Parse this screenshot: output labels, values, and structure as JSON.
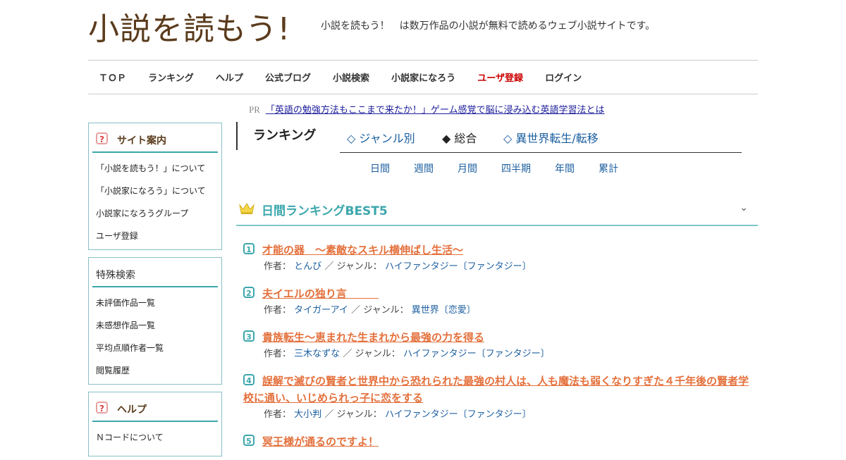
{
  "header": {
    "logo_text": "小説を読もう!",
    "tagline": "小説を読もう！　は数万作品の小説が無料で読めるウェブ小説サイトです。"
  },
  "nav": [
    {
      "label": "ＴＯＰ"
    },
    {
      "label": "ランキング"
    },
    {
      "label": "ヘルプ"
    },
    {
      "label": "公式ブログ"
    },
    {
      "label": "小説検索"
    },
    {
      "label": "小説家になろう"
    },
    {
      "label": "ユーザ登録",
      "color": "#cc0000"
    },
    {
      "label": "ログイン"
    }
  ],
  "pr": {
    "label": "PR",
    "link_text": "「英語の勉強方法もここまで来たか！」ゲーム感覚で脳に浸み込む英語学習法とは"
  },
  "sidebar": {
    "site_guide": {
      "title": "サイト案内",
      "items": [
        "「小説を読もう！」について",
        "「小説家になろう」について",
        "小説家になろうグループ",
        "ユーザ登録"
      ]
    },
    "special_search": {
      "title": "特殊検索",
      "items": [
        "未評価作品一覧",
        "未感想作品一覧",
        "平均点順作者一覧",
        "閲覧履歴"
      ]
    },
    "help": {
      "title": "ヘルプ",
      "items": [
        "Ｎコードについて"
      ]
    }
  },
  "ranking": {
    "title": "ランキング",
    "tabs": [
      "◇ ジャンル別",
      "◆ 総合",
      "◇ 異世界転生/転移"
    ],
    "active_tab": 1,
    "periods": [
      "日間",
      "週間",
      "月間",
      "四半期",
      "年間",
      "累計"
    ],
    "best5_title": "日間ランキングBEST5",
    "author_label": "作者：",
    "genre_label": "／ ジャンル：",
    "items": [
      {
        "rank": "1",
        "title": "才能の器　～素敵なスキル横伸ばし生活～",
        "author": "とんび",
        "genre": "ハイファンタジー〔ファンタジー〕"
      },
      {
        "rank": "2",
        "title": "夫イエルの独り言　　　",
        "author": "タイガーアイ",
        "genre": "異世界〔恋愛〕"
      },
      {
        "rank": "3",
        "title": "貴族転生～恵まれた生まれから最強の力を得る",
        "author": "三木なずな",
        "genre": "ハイファンタジー〔ファンタジー〕"
      },
      {
        "rank": "4",
        "title": "誤解で滅びの賢者と世界中から恐れられた最強の村人は、人も魔法も弱くなりすぎた４千年後の賢者学校に通い、いじめられっ子に恋をする",
        "author": "大小判",
        "genre": "ハイファンタジー〔ファンタジー〕"
      },
      {
        "rank": "5",
        "title": "冥王様が通るのですよ！",
        "author": "",
        "genre": ""
      }
    ]
  },
  "colors": {
    "accent": "#3ba7ac",
    "title_link": "#e4703c",
    "nav_highlight": "#cc0000",
    "logo": "#5a3b1c"
  }
}
